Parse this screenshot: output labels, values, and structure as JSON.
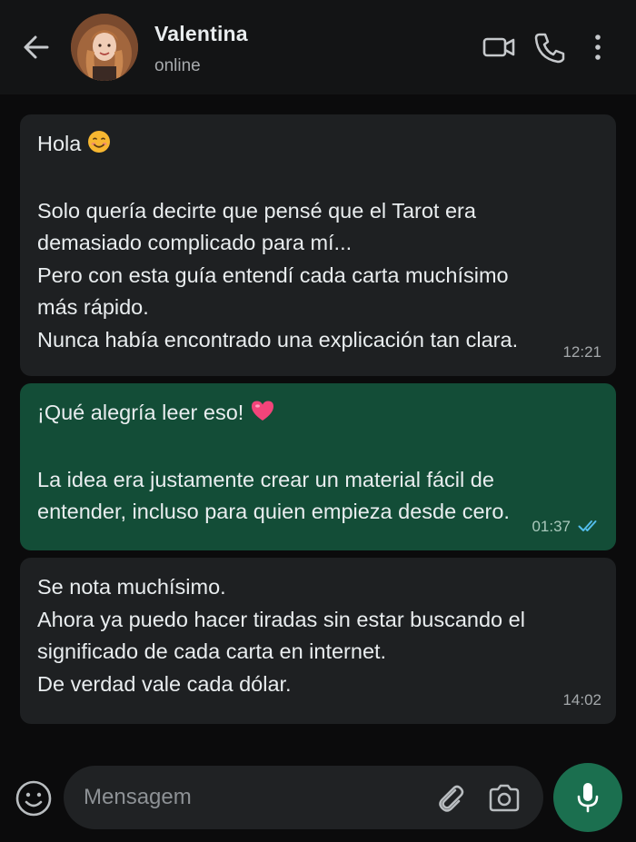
{
  "header": {
    "contact_name": "Valentina",
    "status": "online",
    "icons": [
      "arrow-left-icon",
      "video-call-icon",
      "phone-icon",
      "more-vertical-icon"
    ]
  },
  "messages": [
    {
      "direction": "incoming",
      "greeting": "Hola",
      "emoji": "smiling-face-icon",
      "text": "Solo quería decirte que pensé que el Tarot era\ndemasiado complicado para mí...\nPero con esta guía entendí cada carta muchísimo\nmás rápido.\nNunca había encontrado una explicación tan clara.",
      "time": "12:21"
    },
    {
      "direction": "outgoing",
      "greeting": "¡Qué alegría leer eso!",
      "emoji": "heart-icon",
      "text": "La idea era justamente crear un material fácil de\nentender, incluso para quien empieza desde cero.",
      "time": "01:37",
      "status_icon": "double-check-icon"
    },
    {
      "direction": "incoming",
      "text": "Se nota muchísimo.\nAhora ya puedo hacer tiradas sin estar buscando el\nsignificado de cada carta en internet.\nDe verdad vale cada dólar.",
      "time": "14:02"
    }
  ],
  "composer": {
    "placeholder": "Mensagem",
    "value": "",
    "icons": [
      "emoji-icon",
      "paperclip-icon",
      "camera-icon",
      "microphone-icon"
    ]
  },
  "colors": {
    "background": "#0b0b0c",
    "header": "#131415",
    "incoming_bubble": "#1e2022",
    "outgoing_bubble": "#134d37",
    "accent": "#1b6f4f",
    "read_check": "#53bdeb"
  }
}
